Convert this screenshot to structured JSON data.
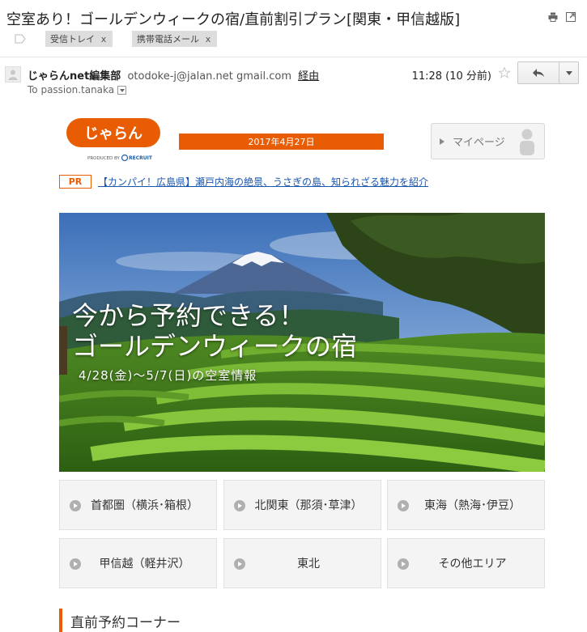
{
  "email": {
    "subject": "空室あり！ゴールデンウィークの宿/直前割引プラン[関東・甲信越版]",
    "labels": [
      "受信トレイ",
      "携帯電話メール"
    ],
    "label_remove": "x",
    "sender_name": "じゃらんnet編集部",
    "sender_address": "otodoke-j@jalan.net gmail.com",
    "via": "経由",
    "recipient": "To passion.tanaka",
    "timestamp": "11:28 (10 分前)"
  },
  "newsletter": {
    "logo_text": "じゃらん",
    "logo_tagline": "PRODUCED BY",
    "logo_brand": "RECRUIT",
    "date": "2017年4月27日",
    "mypage_label": "マイページ",
    "pr_badge": "PR",
    "pr_text": "【カンパイ！広島県】瀬戸内海の絶景、うさぎの島、知られざる魅力を紹介",
    "hero_title_line1": "今から予約できる！",
    "hero_title_line2": "ゴールデンウィークの宿",
    "hero_subtitle": "4/28(金)〜5/7(日)の空室情報",
    "areas": [
      "首都圏（横浜･箱根）",
      "北関東（那須･草津）",
      "東海（熱海･伊豆）",
      "甲信越（軽井沢）",
      "東北",
      "その他エリア"
    ],
    "section_title": "直前予約コーナー"
  },
  "colors": {
    "accent": "#e85d04",
    "link": "#1a56b0",
    "button_bg": "#f4f4f4"
  },
  "icons": [
    "print-icon",
    "new-window-icon",
    "label-icon",
    "avatar-icon",
    "star-icon",
    "reply-icon",
    "caret-down-icon",
    "person-icon",
    "play-circle-icon"
  ]
}
